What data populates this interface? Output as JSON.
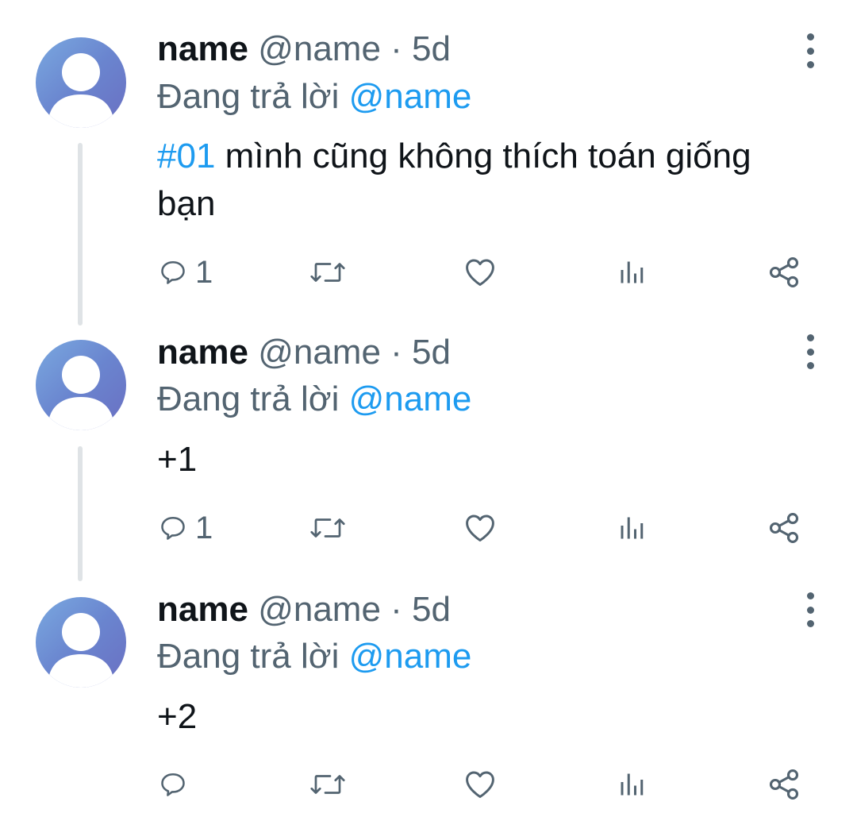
{
  "tweets": [
    {
      "name": "name",
      "handle": "@name",
      "separator": "·",
      "time": "5d",
      "reply_prefix": "Đang trả lời",
      "reply_mention": "@name",
      "hashtag": "#01",
      "text": " mình cũng không thích toán giống bạn",
      "reply_count": "1"
    },
    {
      "name": "name",
      "handle": "@name",
      "separator": "·",
      "time": "5d",
      "reply_prefix": "Đang trả lời",
      "reply_mention": "@name",
      "hashtag": "",
      "text": "+1",
      "reply_count": "1"
    },
    {
      "name": "name",
      "handle": "@name",
      "separator": "·",
      "time": "5d",
      "reply_prefix": "Đang trả lời",
      "reply_mention": "@name",
      "hashtag": "",
      "text": "+2",
      "reply_count": ""
    }
  ],
  "icons": {
    "avatar": "default-user-avatar",
    "more": "more-vertical-icon",
    "reply": "reply-bubble-icon",
    "retweet": "retweet-icon",
    "like": "heart-icon",
    "views": "analytics-icon",
    "share": "share-icon"
  },
  "colors": {
    "text": "#0f1419",
    "secondary": "#536471",
    "accent": "#1d9bf0",
    "thread_line": "#dfe3e6"
  }
}
